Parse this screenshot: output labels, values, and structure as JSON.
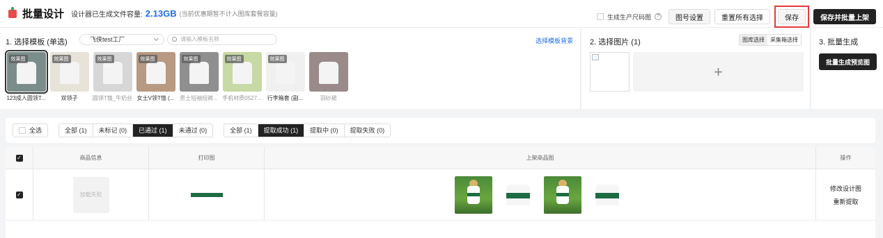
{
  "header": {
    "title": "批量设计",
    "capacity_label": "设计器已生成文件容量:",
    "capacity_value": "2.13GB",
    "capacity_note": "(当前优惠期暂不计入图库套餐容量)",
    "gen_size_label": "生成生产尺码图",
    "btn_number": "图号设置",
    "btn_reset": "重置所有选择",
    "btn_save": "保存",
    "btn_save_publish": "保存并批量上架"
  },
  "step1": {
    "title": "1. 选择模板 (单选)",
    "factory": "飞侠test工厂",
    "search_placeholder": "请输入模板名称",
    "bg_link": "选择模板背景",
    "templates": [
      {
        "label": "123成人圆领T...",
        "tag": "效果图",
        "color": "#7b8d8a"
      },
      {
        "label": "双领子",
        "tag": "效果图",
        "color": "#e8e3d9"
      },
      {
        "label": "圆领T恤_牛奶丝",
        "tag": "效果图",
        "color": "#d7d7d7"
      },
      {
        "label": "女士V领T恤 (...",
        "tag": "效果图",
        "color": "#b89a82"
      },
      {
        "label": "男士短袖短裤...",
        "tag": "效果图",
        "color": "#8f8f8f"
      },
      {
        "label": "手机材质0527...",
        "tag": "效果图",
        "color": "#c7d9a4"
      },
      {
        "label": "行李箱套 (副...",
        "tag": "效果图",
        "color": "#f0f0f0"
      },
      {
        "label": "羽纱裙",
        "tag": "",
        "color": "#9a8a8a"
      }
    ]
  },
  "step2": {
    "title": "2. 选择图片 (1)",
    "tab_library": "图库选择",
    "tab_collect": "采集箱选择",
    "add": "+"
  },
  "step3": {
    "title": "3. 批量生成",
    "btn_preview": "批量生成预览图"
  },
  "filters": {
    "select_all": "全选",
    "group1": [
      "全部 (1)",
      "未标记 (0)",
      "已通过 (1)",
      "未通过 (0)"
    ],
    "group2": [
      "全部 (1)",
      "提取成功 (1)",
      "提取中 (0)",
      "提取失败 (0)"
    ]
  },
  "table": {
    "headers": [
      "商品信息",
      "打印图",
      "上架商品图",
      "操作"
    ],
    "row": {
      "load_fail": "加载失败",
      "op_modify": "修改设计图",
      "op_reextract": "重新提取"
    }
  },
  "colors": {
    "accent_dark": "#222222",
    "brand_blue": "#1f6fe0",
    "highlight_red": "#e23a3a",
    "print_green": "#1d6b43"
  }
}
